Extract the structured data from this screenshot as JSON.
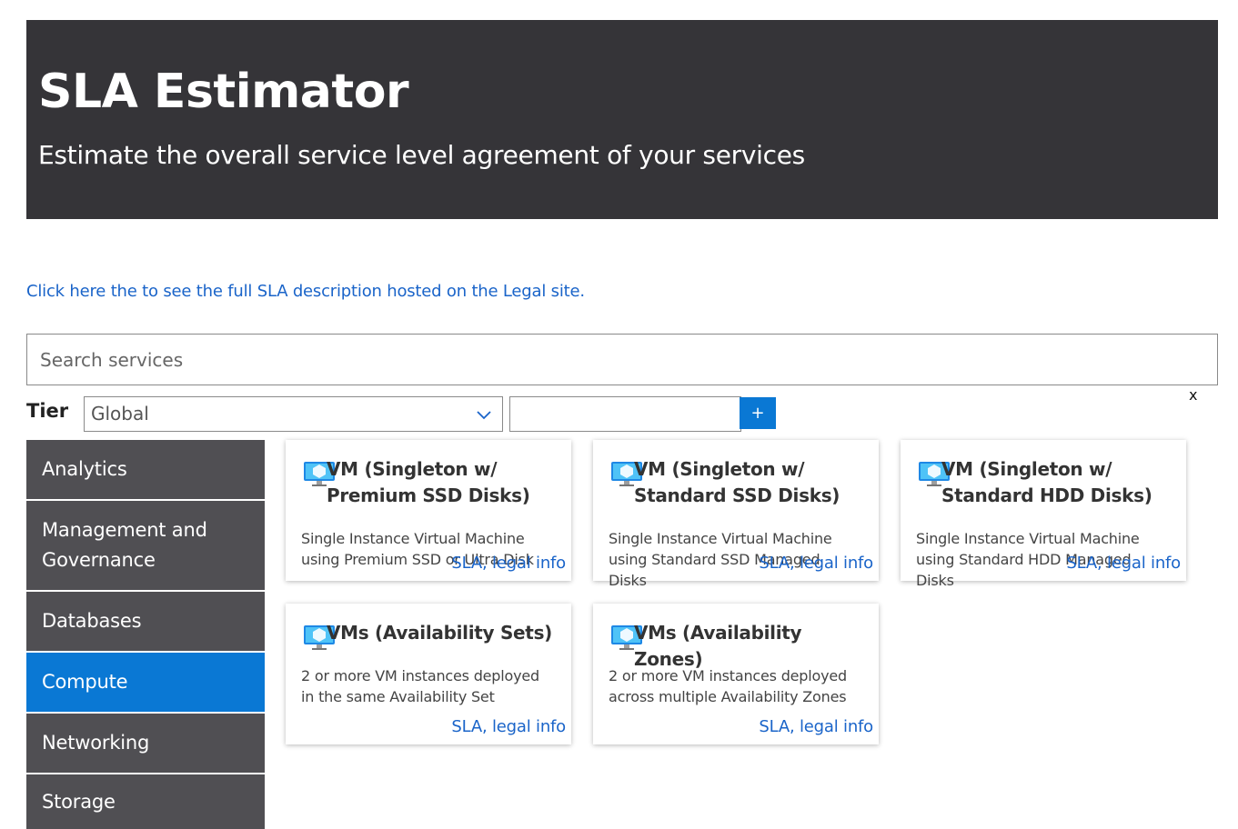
{
  "header": {
    "title": "SLA Estimator",
    "subtitle": "Estimate the overall service level agreement of your services"
  },
  "legal_link": "Click here the to see the full SLA description hosted on the Legal site.",
  "search": {
    "placeholder": "Search services",
    "value": ""
  },
  "tier": {
    "label": "Tier",
    "selected": "Global",
    "input_value": "",
    "add_label": "+",
    "close_label": "x"
  },
  "sidebar": {
    "items": [
      {
        "label": "Analytics",
        "active": false
      },
      {
        "label": "Management and Governance",
        "active": false
      },
      {
        "label": "Databases",
        "active": false
      },
      {
        "label": "Compute",
        "active": true
      },
      {
        "label": "Networking",
        "active": false
      },
      {
        "label": "Storage",
        "active": false
      }
    ]
  },
  "cards": [
    {
      "icon": "virtual-machine-icon",
      "title": "VM (Singleton w/ Premium SSD Disks)",
      "description": "Single Instance Virtual Machine using Premium SSD or Ultra Disk",
      "link": "SLA, legal info"
    },
    {
      "icon": "virtual-machine-icon",
      "title": "VM (Singleton w/ Standard SSD Disks)",
      "description": "Single Instance Virtual Machine using Standard SSD Managed Disks",
      "link": "SLA, legal info"
    },
    {
      "icon": "virtual-machine-icon",
      "title": "VM (Singleton w/ Standard HDD Disks)",
      "description": "Single Instance Virtual Machine using Standard HDD Managed Disks",
      "link": "SLA, legal info"
    },
    {
      "icon": "virtual-machine-icon",
      "title": "VMs (Availability Sets)",
      "description": "2 or more VM instances deployed in the same Availability Set",
      "link": "SLA, legal info"
    },
    {
      "icon": "virtual-machine-icon",
      "title": "VMs (Availability Zones)",
      "description": "2 or more VM instances deployed across multiple Availability Zones",
      "link": "SLA, legal info"
    }
  ],
  "colors": {
    "header_bg": "#353438",
    "sidebar_bg": "#504f53",
    "accent": "#0a78d4",
    "link": "#1a64c9"
  }
}
